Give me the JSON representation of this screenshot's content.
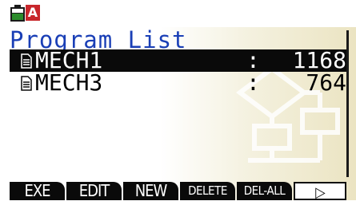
{
  "status": {
    "battery_icon": "battery-icon",
    "alpha_indicator": "A"
  },
  "title": "Program List",
  "programs": [
    {
      "name": "MECH1",
      "separator": ":",
      "size": "1168",
      "selected": true
    },
    {
      "name": "MECH3",
      "separator": ":",
      "size": "764",
      "selected": false
    }
  ],
  "function_keys": [
    {
      "label": "EXE"
    },
    {
      "label": "EDIT"
    },
    {
      "label": "NEW"
    },
    {
      "label": "DELETE"
    },
    {
      "label": "DEL-ALL"
    },
    {
      "label": "▷"
    }
  ],
  "colors": {
    "title": "#1a3fb6",
    "selection": "#0a0a0a",
    "alpha_badge": "#c8262b"
  }
}
